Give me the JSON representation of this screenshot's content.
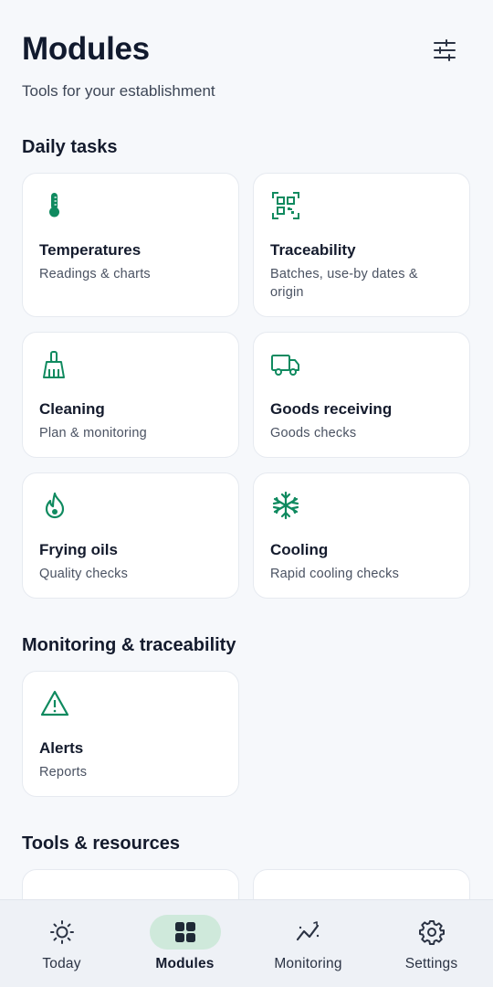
{
  "header": {
    "title": "Modules",
    "subtitle": "Tools for your establishment",
    "filter_icon": "sliders-icon"
  },
  "accent_color": "#0f8a5f",
  "sections": {
    "daily": {
      "title": "Daily tasks",
      "cards": [
        {
          "icon": "thermometer-icon",
          "title": "Temperatures",
          "subtitle": "Readings & charts"
        },
        {
          "icon": "qr-code-icon",
          "title": "Traceability",
          "subtitle": "Batches, use-by dates & origin"
        },
        {
          "icon": "broom-icon",
          "title": "Cleaning",
          "subtitle": "Plan & monitoring"
        },
        {
          "icon": "truck-icon",
          "title": "Goods receiving",
          "subtitle": "Goods checks"
        },
        {
          "icon": "flame-icon",
          "title": "Frying oils",
          "subtitle": "Quality checks"
        },
        {
          "icon": "snowflake-icon",
          "title": "Cooling",
          "subtitle": "Rapid cooling checks"
        }
      ]
    },
    "monitoring": {
      "title": "Monitoring & traceability",
      "cards": [
        {
          "icon": "warning-icon",
          "title": "Alerts",
          "subtitle": "Reports"
        }
      ]
    },
    "tools": {
      "title": "Tools & resources"
    }
  },
  "bottom_nav": [
    {
      "icon": "sun-icon",
      "label": "Today",
      "active": false
    },
    {
      "icon": "grid-icon",
      "label": "Modules",
      "active": true
    },
    {
      "icon": "trend-icon",
      "label": "Monitoring",
      "active": false
    },
    {
      "icon": "gear-icon",
      "label": "Settings",
      "active": false
    }
  ]
}
